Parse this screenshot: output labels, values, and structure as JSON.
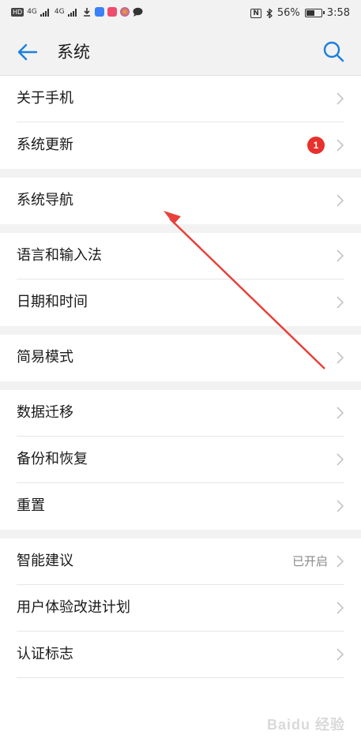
{
  "status_bar": {
    "hd_label": "HD",
    "net1": "4G",
    "net2": "4G",
    "nfc": "N",
    "battery": "56%",
    "battery_level": 0.56,
    "time": "3:58"
  },
  "header": {
    "back_icon": "arrow-left-icon",
    "title": "系统",
    "search_icon": "search-icon"
  },
  "groups": [
    {
      "items": [
        {
          "label": "关于手机"
        },
        {
          "label": "系统更新",
          "badge": "1"
        }
      ]
    },
    {
      "items": [
        {
          "label": "系统导航"
        }
      ]
    },
    {
      "items": [
        {
          "label": "语言和输入法"
        },
        {
          "label": "日期和时间"
        }
      ]
    },
    {
      "items": [
        {
          "label": "简易模式"
        }
      ]
    },
    {
      "items": [
        {
          "label": "数据迁移"
        },
        {
          "label": "备份和恢复"
        },
        {
          "label": "重置"
        }
      ]
    },
    {
      "items": [
        {
          "label": "智能建议",
          "value": "已开启"
        },
        {
          "label": "用户体验改进计划"
        },
        {
          "label": "认证标志"
        }
      ]
    }
  ],
  "colors": {
    "accent": "#1a7fdd",
    "badge": "#e8312c",
    "annotation_arrow": "#e8403a"
  },
  "watermark": "Baidu 经验"
}
